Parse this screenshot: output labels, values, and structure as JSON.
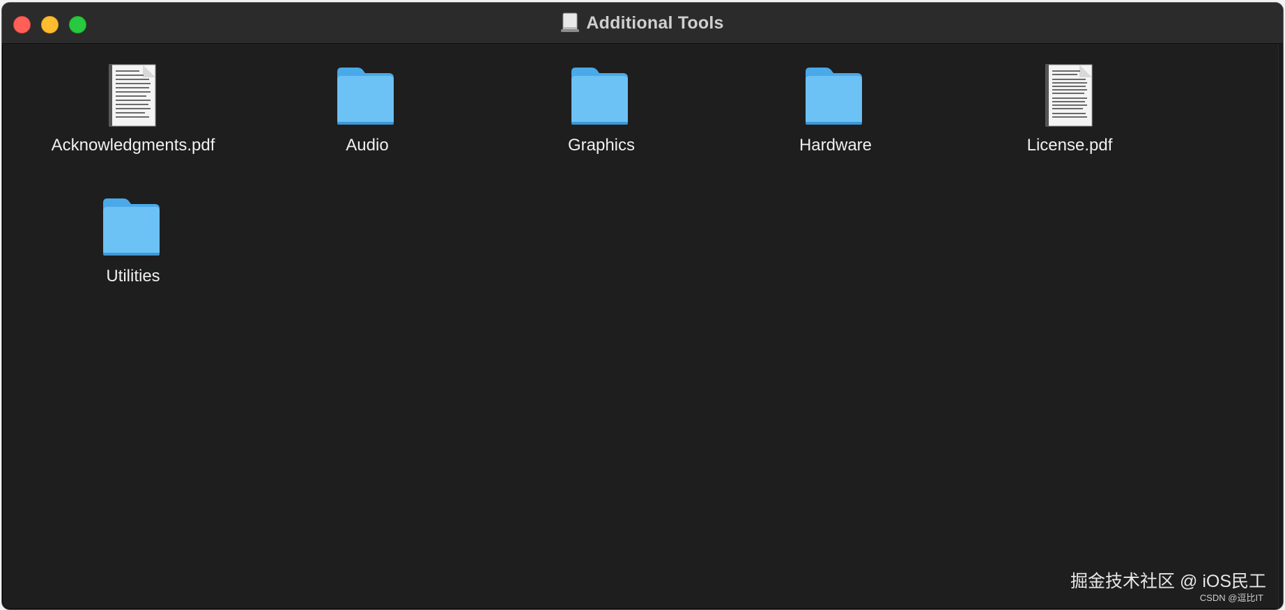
{
  "window": {
    "title": "Additional Tools",
    "title_icon": "disk-image-icon"
  },
  "items": [
    {
      "name": "Acknowledgments.pdf",
      "kind": "pdf",
      "icon": "pdf-document-icon"
    },
    {
      "name": "Audio",
      "kind": "folder",
      "icon": "folder-icon"
    },
    {
      "name": "Graphics",
      "kind": "folder",
      "icon": "folder-icon"
    },
    {
      "name": "Hardware",
      "kind": "folder",
      "icon": "folder-icon"
    },
    {
      "name": "License.pdf",
      "kind": "pdf",
      "icon": "pdf-document-icon"
    },
    {
      "name": "Utilities",
      "kind": "folder",
      "icon": "folder-icon"
    }
  ],
  "watermark": {
    "main": "掘金技术社区 @ iOS民工",
    "sub": "CSDN @逗比IT"
  },
  "colors": {
    "window_bg": "#1e1e1e",
    "titlebar_bg": "#2b2b2b",
    "folder_blue": "#6cc1f5",
    "close": "#fe5f57",
    "minimize": "#febc2e",
    "zoom": "#28c840"
  }
}
